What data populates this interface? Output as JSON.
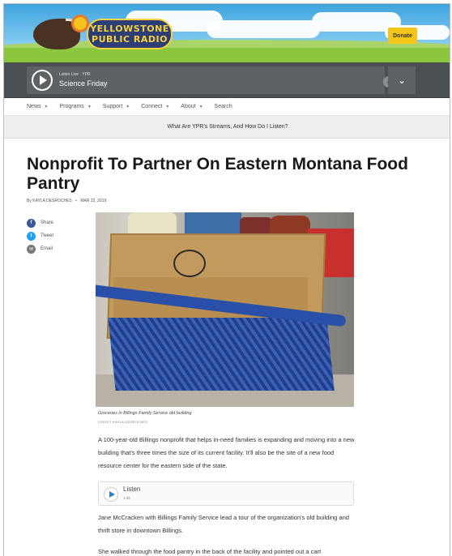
{
  "header": {
    "logo_line1": "YELLOWSTONE",
    "logo_line2": "PUBLIC RADIO",
    "donate_label": "Donate"
  },
  "player": {
    "live_label": "Listen Live · YPR",
    "show_title": "Science Friday"
  },
  "nav": {
    "items": [
      {
        "label": "News",
        "has_caret": true
      },
      {
        "label": "Programs",
        "has_caret": true
      },
      {
        "label": "Support",
        "has_caret": true
      },
      {
        "label": "Connect",
        "has_caret": true
      },
      {
        "label": "About",
        "has_caret": true
      },
      {
        "label": "Search",
        "has_caret": false
      }
    ],
    "caret_glyph": "▼"
  },
  "announcement": "What Are YPR's Streams, And How Do I Listen?",
  "article": {
    "headline": "Nonprofit To Partner On Eastern Montana Food Pantry",
    "byline_prefix": "By",
    "author": "KAYLA DESROCHES",
    "date": "MAR 22, 2019",
    "share": {
      "facebook": "Share",
      "twitter": "Tweet",
      "email": "Email"
    },
    "photo_caption": "Groceries in Billings Family Service old building",
    "photo_credit": "CREDIT KAYLA DESROCHES",
    "paragraph1": "A 100-year-old Billings nonprofit that helps in-need families is expanding and moving into a new building that's three times the size of its current facility. It'll also be the site of a new food resource center for the eastern side of the state.",
    "listen_label": "Listen",
    "listen_duration": "1:46",
    "paragraph2": "Jane McCracken with Billings Family Service lead a tour of the organization's old building and thrift store in downtown Billings.",
    "paragraph3": "She walked through the food pantry in the back of the facility and pointed out a cart"
  },
  "icons": {
    "play": "play-icon",
    "volume": "volume-icon",
    "expand": "chevron-down-icon",
    "facebook": "facebook-icon",
    "twitter": "twitter-icon",
    "email": "email-icon"
  },
  "colors": {
    "donate": "#f5c518",
    "player_bg": "#4a4f52",
    "facebook": "#3b5998",
    "twitter": "#1da1f2",
    "listen_play": "#2f7fd1"
  }
}
